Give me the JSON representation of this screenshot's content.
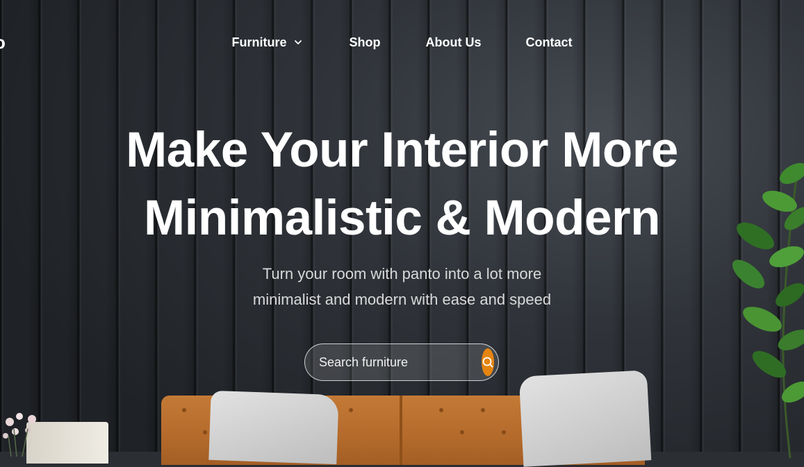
{
  "brand": {
    "logo_fragment": "o"
  },
  "nav": {
    "items": [
      {
        "label": "Furniture",
        "has_dropdown": true
      },
      {
        "label": "Shop",
        "has_dropdown": false
      },
      {
        "label": "About Us",
        "has_dropdown": false
      },
      {
        "label": "Contact",
        "has_dropdown": false
      }
    ],
    "dropdown_icon": "chevron-down-icon"
  },
  "hero": {
    "title_line1": "Make Your Interior More",
    "title_line2": "Minimalistic & Modern",
    "subtitle_line1": "Turn your room with panto into a lot more",
    "subtitle_line2": "minimalist and modern with ease and speed"
  },
  "search": {
    "placeholder": "Search furniture",
    "value": "",
    "icon": "search-icon",
    "accent": "#e58411"
  },
  "colors": {
    "background": "#2b2e33",
    "text": "#ffffff",
    "accent": "#e58411",
    "sofa": "#b46a2b"
  }
}
